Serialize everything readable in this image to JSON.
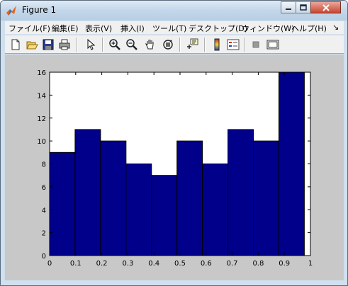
{
  "window": {
    "title": "Figure 1"
  },
  "menu": {
    "items": [
      "ファイル(F)",
      "編集(E)",
      "表示(V)",
      "挿入(I)",
      "ツール(T)",
      "デスクトップ(D)",
      "ウィンドウ(W)",
      "ヘルプ(H)"
    ],
    "overflow": "↘"
  },
  "toolbar": {
    "icons": [
      "new-figure-icon",
      "open-file-icon",
      "save-icon",
      "print-icon",
      "edit-plot-arrow-icon",
      "zoom-in-icon",
      "zoom-out-icon",
      "pan-hand-icon",
      "rotate-3d-icon",
      "data-cursor-icon",
      "colorbar-icon",
      "legend-icon",
      "hide-plot-tools-icon",
      "show-plot-tools-icon"
    ]
  },
  "colors": {
    "bar_fill": "#00008b",
    "bar_edge": "#000000",
    "figure_bg": "#c8c8c8",
    "axes_bg": "#ffffff"
  },
  "chart_data": {
    "type": "bar",
    "title": "",
    "xlabel": "",
    "ylabel": "",
    "bin_edges": [
      0.0,
      0.0976,
      0.1953,
      0.293,
      0.3906,
      0.4883,
      0.586,
      0.6836,
      0.7813,
      0.879,
      0.9766
    ],
    "values": [
      9,
      11,
      10,
      8,
      7,
      10,
      8,
      11,
      10,
      16
    ],
    "xlim": [
      0,
      1
    ],
    "ylim": [
      0,
      16
    ],
    "xticks": [
      "0",
      "0.1",
      "0.2",
      "0.3",
      "0.4",
      "0.5",
      "0.6",
      "0.7",
      "0.8",
      "0.9",
      "1"
    ],
    "yticks": [
      "0",
      "2",
      "4",
      "6",
      "8",
      "10",
      "12",
      "14",
      "16"
    ],
    "grid": false
  }
}
